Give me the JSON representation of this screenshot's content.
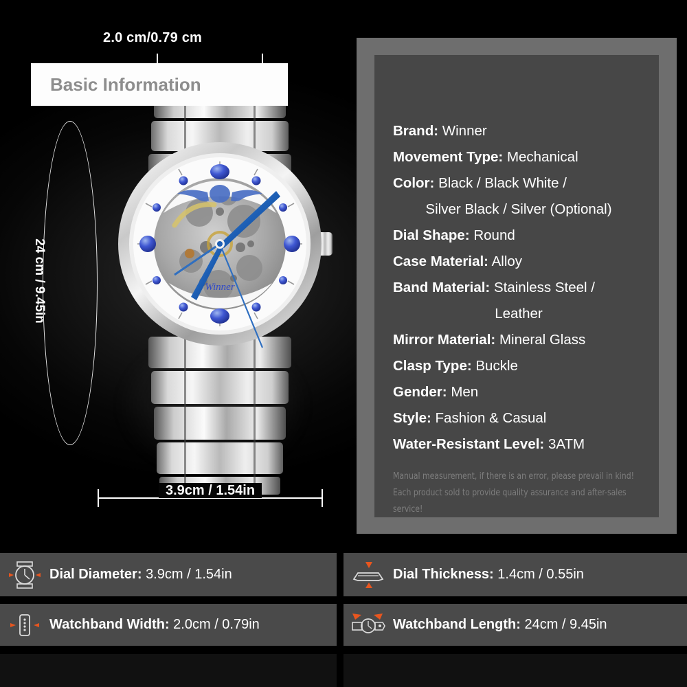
{
  "product_image": {
    "dimensions": {
      "band_width": "2.0 cm/0.79 cm",
      "band_length": "24 cm / 9.45in",
      "dial_diameter": "3.9cm / 1.54in"
    },
    "dial_brand_text": "Winner"
  },
  "info_panel": {
    "heading": "Basic Information",
    "specs": [
      {
        "label": "Brand:",
        "value": "Winner"
      },
      {
        "label": "Movement Type:",
        "value": "Mechanical"
      },
      {
        "label": "Color:",
        "value": "Black / Black White /",
        "continuation": "Silver Black / Silver (Optional)"
      },
      {
        "label": "Dial Shape:",
        "value": "Round"
      },
      {
        "label": "Case Material:",
        "value": "Alloy"
      },
      {
        "label": "Band Material:",
        "value": "Stainless Steel /",
        "continuation": "Leather"
      },
      {
        "label": "Mirror Material:",
        "value": "Mineral Glass"
      },
      {
        "label": "Clasp Type:",
        "value": "Buckle"
      },
      {
        "label": "Gender:",
        "value": "Men"
      },
      {
        "label": "Style:",
        "value": "Fashion & Casual"
      },
      {
        "label": "Water-Resistant Level:",
        "value": "3ATM"
      }
    ],
    "notes": [
      "Manual measurement, if there is an error, please prevail in kind!",
      "Each product sold to provide quality assurance and after-sales service!"
    ]
  },
  "measurement_bars": [
    {
      "icon": "watch-dial-icon",
      "label": "Dial Diameter:",
      "value": "3.9cm / 1.54in"
    },
    {
      "icon": "watch-side-icon",
      "label": "Dial Thickness:",
      "value": "1.4cm / 0.55in"
    },
    {
      "icon": "watchband-width-icon",
      "label": "Watchband Width:",
      "value": "2.0cm / 0.79in"
    },
    {
      "icon": "watchband-length-icon",
      "label": "Watchband Length:",
      "value": "24cm / 9.45in"
    }
  ],
  "colors": {
    "accent_orange": "#e8561f",
    "panel_outer": "#6e6e6e",
    "panel_inner": "#474747",
    "bar_bg": "#4a4a4a",
    "heading_text": "#8d8d8d",
    "note_text": "#7d7d7d",
    "dial_blue": "#2f49c8"
  }
}
